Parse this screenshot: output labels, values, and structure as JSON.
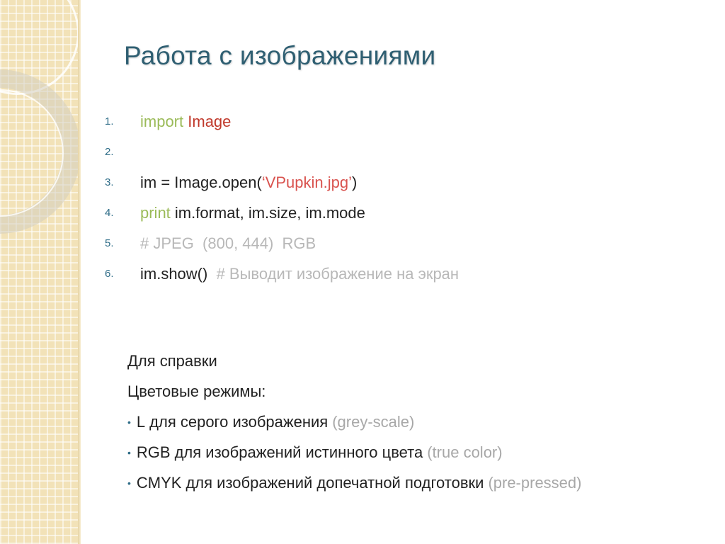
{
  "title": "Работа с изображениями",
  "code": [
    {
      "num": "1.",
      "keyword": "import",
      "class_name": "Image"
    },
    {
      "num": "2."
    },
    {
      "num": "3.",
      "pre": "im = Image.open(",
      "string": "‘VPupkin.jpg’",
      "post": ")"
    },
    {
      "num": "4.",
      "keyword": "print",
      "rest": "im.format, im.size, im.mode"
    },
    {
      "num": "5.",
      "comment": "# JPEG  (800, 444)  RGB"
    },
    {
      "num": "6.",
      "code": "im.show()",
      "comment": "# Выводит изображение на экран"
    }
  ],
  "reference": {
    "heading": "Для справки",
    "subheading": "Цветовые режимы:",
    "bullet_char": "•",
    "items": [
      {
        "mode": "L",
        "desc": "для серого изображения",
        "note": "(grey-scale)"
      },
      {
        "mode": "RGB",
        "desc": "для изображений истинного цвета",
        "note": "(true color)"
      },
      {
        "mode": "CMYK",
        "desc": "для изображений допечатной подготовки",
        "note": "(pre-pressed)"
      }
    ]
  },
  "colors": {
    "title": "#2f5f72",
    "keyword": "#9bbb59",
    "class": "#c0392b",
    "string": "#d9534f",
    "comment": "#b8b8b8",
    "strip": "#f2e2b8"
  }
}
